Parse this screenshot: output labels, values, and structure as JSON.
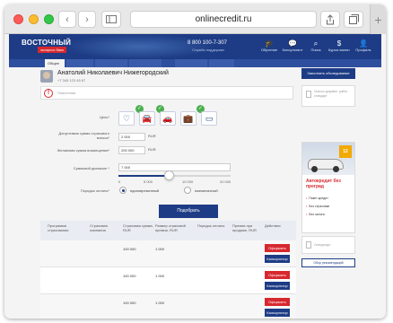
{
  "browser": {
    "url": "onlinecredit.ru",
    "back_icon": "chevron-left-icon",
    "forward_icon": "chevron-right-icon",
    "sidebar_icon": "sidebar-icon",
    "share_icon": "share-icon",
    "tabs_icon": "tabs-icon",
    "new_tab": "+"
  },
  "header": {
    "logo": "ВОСТОЧНЫЙ",
    "logo_sub": "экспресс банк",
    "phone": "8 800 100-7-307",
    "phone_sub": "Служба поддержки",
    "nav": [
      {
        "label": "Обучение",
        "icon": "graduation-icon",
        "glyph": "🎓"
      },
      {
        "label": "Консультант",
        "icon": "chat-icon",
        "glyph": "💬"
      },
      {
        "label": "Поиск",
        "icon": "search-icon",
        "glyph": "⌕"
      },
      {
        "label": "Курсы валют",
        "icon": "currency-icon",
        "glyph": "$"
      },
      {
        "label": "Профиль",
        "icon": "user-icon",
        "glyph": "👤"
      }
    ]
  },
  "tabs": [
    "Общее",
    "",
    "",
    "",
    "",
    ""
  ],
  "user": {
    "name": "Анатолий Николаевич Нижегородский",
    "phone": "+7 345 123 45 67"
  },
  "notice": {
    "text": "Пояснения"
  },
  "form": {
    "goal_label": "Цель*",
    "goals": [
      {
        "icon": "heart-icon",
        "glyph": "♡",
        "checked": true
      },
      {
        "icon": "car-icon",
        "glyph": "🚘",
        "checked": true
      },
      {
        "icon": "car-front-icon",
        "glyph": "🚗",
        "checked": false
      },
      {
        "icon": "briefcase-icon",
        "glyph": "💼",
        "checked": true
      },
      {
        "icon": "card-icon",
        "glyph": "▭",
        "checked": false
      }
    ],
    "amount_label": "Допустимая сумма страхового взноса*",
    "amount_value": "2 000",
    "amount_unit": "RUR",
    "comp_label": "Желаемая сумма возмещения*",
    "comp_value": "200 000",
    "comp_unit": "RUR",
    "range_label": "Суммовой диапазон *",
    "range_value": "7 000",
    "range_ticks": [
      "0",
      "5 000",
      "10 000",
      "20 000"
    ],
    "range_level": 0.45,
    "payment_label": "Порядок оплаты*",
    "payment_options": [
      "единовременный",
      "ежемесячный"
    ],
    "payment_selected": 0,
    "submit": "Подобрать"
  },
  "table": {
    "headers": [
      "Программа страхования",
      "Страховая компания",
      "Страховая сумма, RUR",
      "Размер страховой премии, RUR",
      "Порядок оплаты",
      "Премия при продаже, RUR",
      "Действия"
    ],
    "rows": [
      {
        "sum": "100 000",
        "premium": "1 000"
      },
      {
        "sum": "100 000",
        "premium": "1 000"
      },
      {
        "sum": "100 000",
        "premium": "1 000"
      }
    ],
    "btn_apply": "Оформить",
    "btn_calc": "Калькулятор"
  },
  "sidebar": {
    "apply_button": "Заполнить обследование",
    "doc_text": "Список докумен. работ стандарт",
    "ad": {
      "badge": "12",
      "title": "Автокредит без преград",
      "items": [
        "Пакет-кредит",
        "Без страховки",
        "Без залога"
      ]
    },
    "print_text": "Спецпредл.",
    "compare_button": "Обор рекомендаций"
  }
}
